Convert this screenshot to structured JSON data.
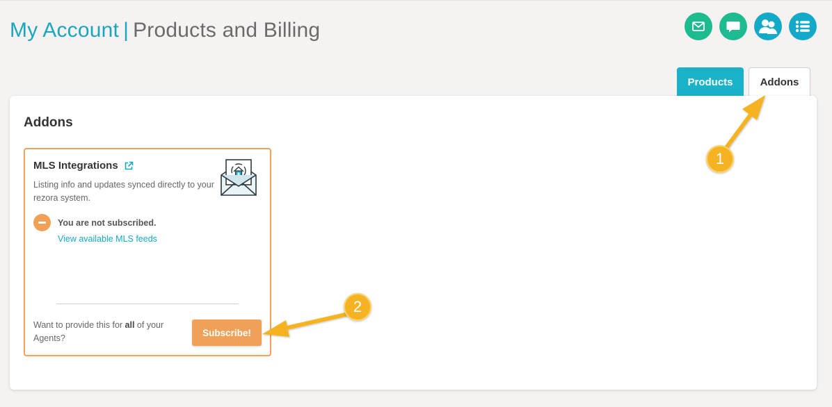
{
  "header": {
    "title_main": "My Account",
    "separator": "|",
    "title_sub": "Products and Billing",
    "icons": [
      "mail-icon",
      "chat-icon",
      "users-icon",
      "list-menu-icon"
    ]
  },
  "tabs": [
    {
      "label": "Products",
      "active": false
    },
    {
      "label": "Addons",
      "active": true
    }
  ],
  "section": {
    "heading": "Addons"
  },
  "addon_card": {
    "title": "MLS Integrations",
    "description": "Listing info and updates synced directly to your rezora system.",
    "status_text": "You are not subscribed.",
    "feeds_link": "View available MLS feeds",
    "footer_prefix": "Want to provide this for ",
    "footer_bold": "all",
    "footer_suffix": " of your Agents?",
    "subscribe_label": "Subscribe!"
  },
  "annotations": {
    "marker_1": "1",
    "marker_2": "2"
  },
  "colors": {
    "teal": "#13a9c8",
    "green": "#1dbb8f",
    "orange": "#f0a057",
    "annotation": "#f5b323",
    "background": "#f5f2f1"
  }
}
